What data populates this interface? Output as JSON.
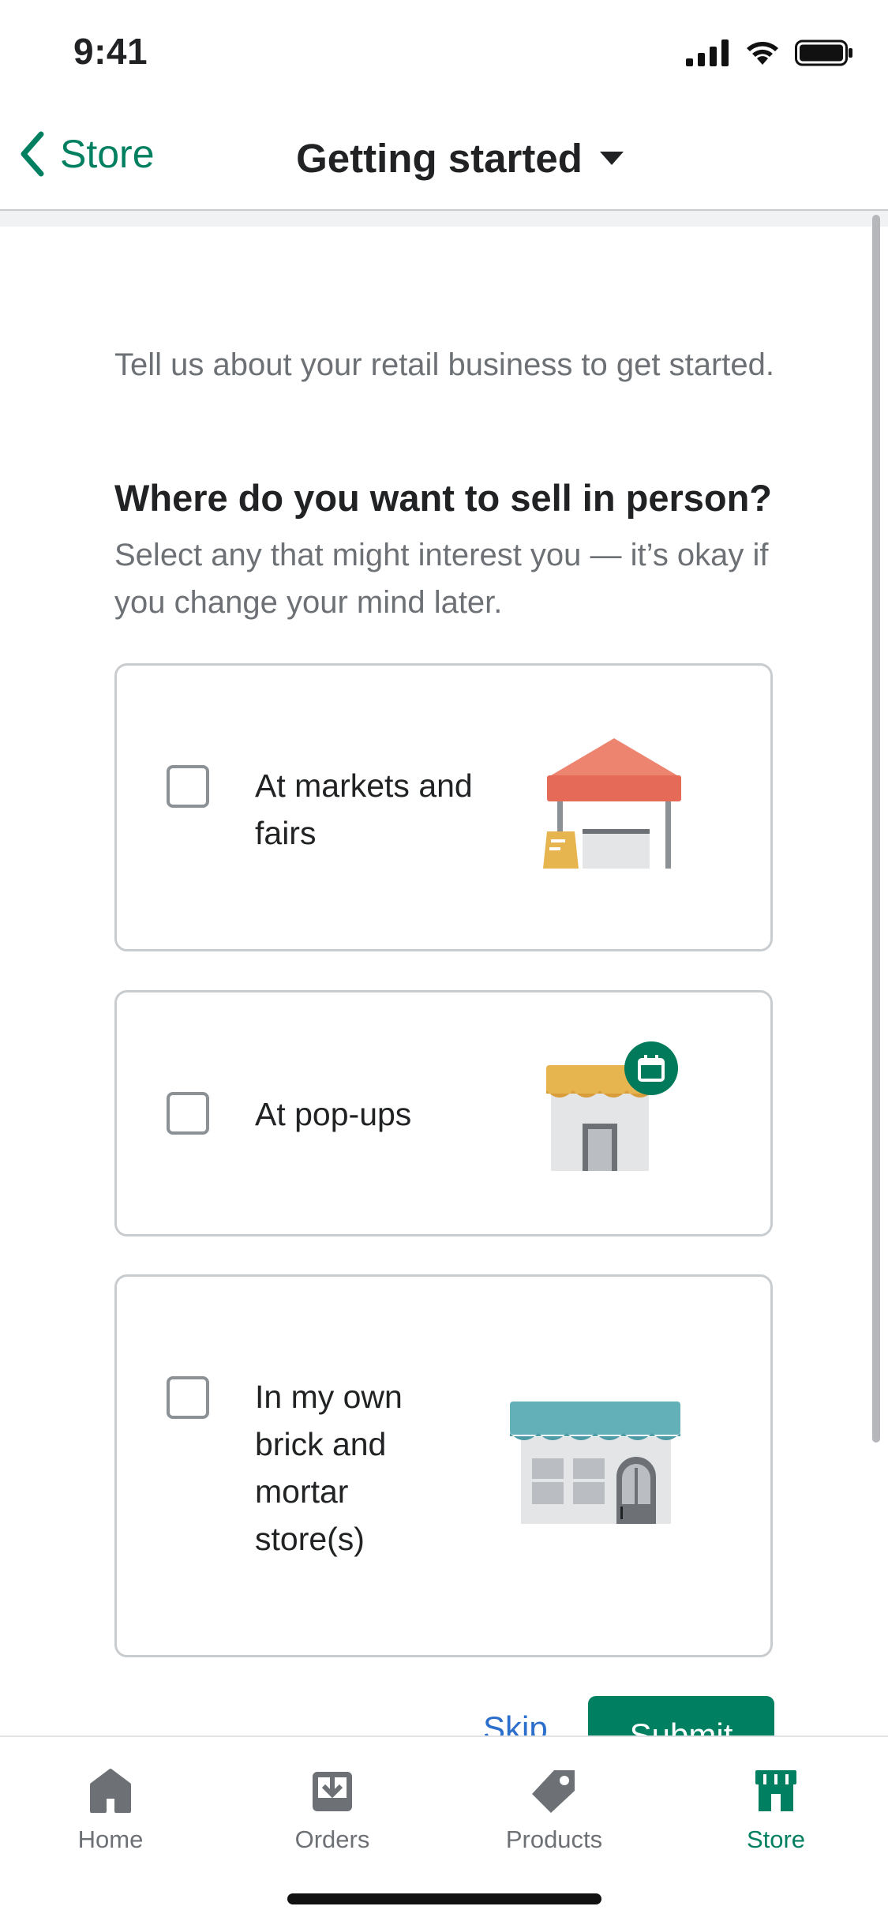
{
  "status_bar": {
    "time": "9:41"
  },
  "nav": {
    "back_label": "Store",
    "title": "Getting started"
  },
  "intro": "Tell us about your retail business to get started.",
  "question": "Where do you want to sell in person?",
  "helper": "Select any that might interest you — it’s okay if you change your mind later.",
  "options": [
    {
      "label": "At markets and fairs",
      "checked": false,
      "icon": "market-tent-icon"
    },
    {
      "label": "At pop-ups",
      "checked": false,
      "icon": "popup-shop-icon"
    },
    {
      "label": "In my own brick and mortar store(s)",
      "checked": false,
      "icon": "storefront-icon"
    }
  ],
  "actions": {
    "skip_label": "Skip",
    "submit_label": "Submit"
  },
  "tabs": [
    {
      "label": "Home",
      "icon": "home-icon",
      "active": false
    },
    {
      "label": "Orders",
      "icon": "orders-icon",
      "active": false
    },
    {
      "label": "Products",
      "icon": "tag-icon",
      "active": false
    },
    {
      "label": "Store",
      "icon": "store-icon",
      "active": true
    }
  ],
  "colors": {
    "accent": "#008060",
    "link": "#2c6ecb",
    "muted_text": "#6d7175",
    "border": "#c9cccf"
  }
}
